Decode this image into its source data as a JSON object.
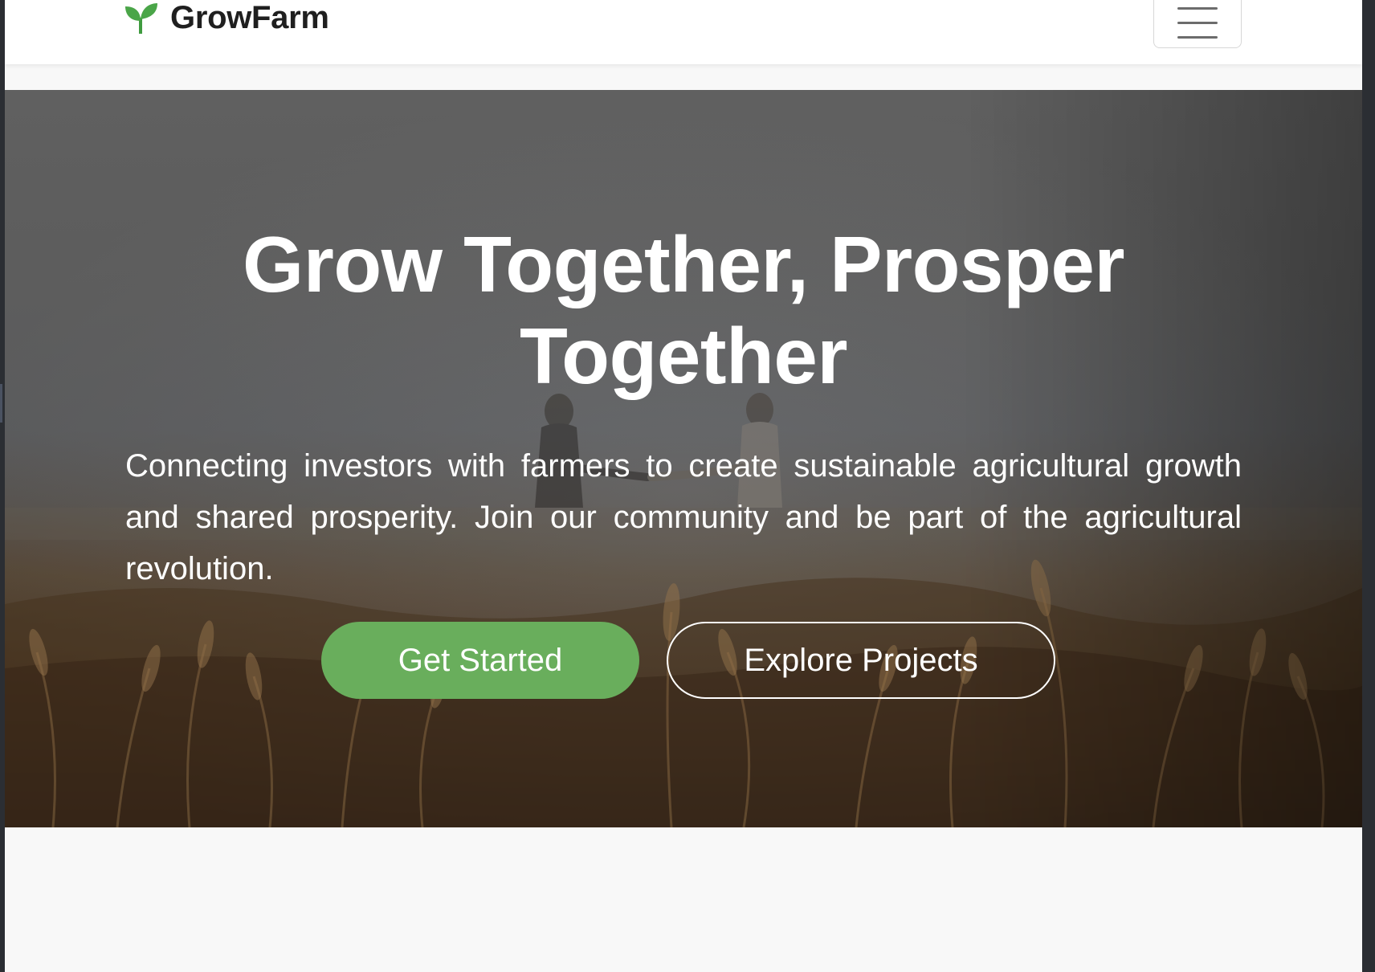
{
  "header": {
    "brand_name": "GrowFarm",
    "brand_icon": "seedling-icon",
    "menu_icon": "hamburger-menu-icon"
  },
  "hero": {
    "title": "Grow Together, Prosper Together",
    "subtitle": "Connecting investors with farmers to create sustainable agricultural growth and shared prosperity. Join our community and be part of the agricultural revolution.",
    "primary_button_label": "Get Started",
    "secondary_button_label": "Explore Projects",
    "background_image": "wheat-field-handshake-photo"
  },
  "colors": {
    "accent_green": "#69ae5c",
    "header_bg": "#ffffff",
    "page_bg": "#f8f8f8",
    "hero_text": "#ffffff"
  }
}
